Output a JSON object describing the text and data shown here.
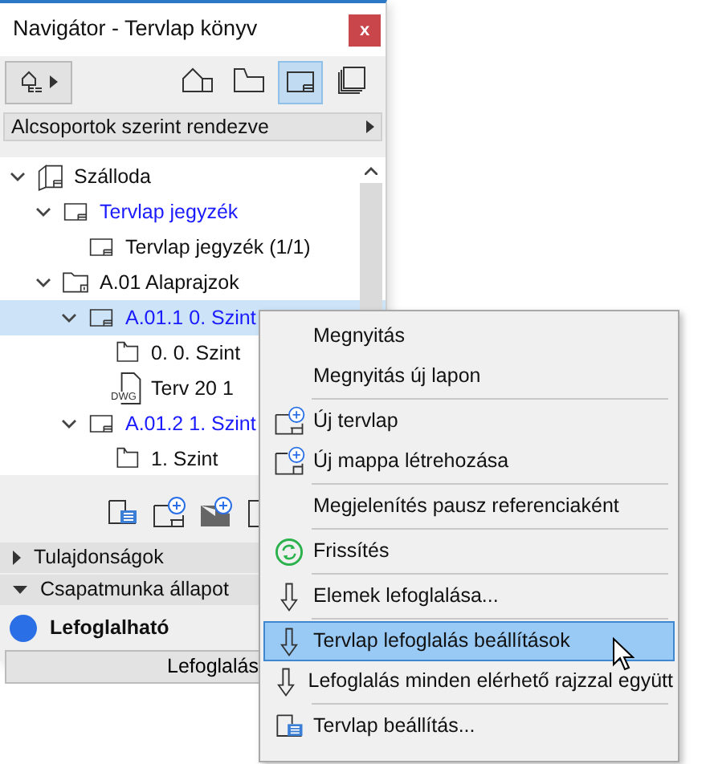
{
  "window": {
    "title": "Navigátor - Tervlap könyv",
    "close_label": "x"
  },
  "toolbar": {
    "views": [
      {
        "kind": "model",
        "selected": false
      },
      {
        "kind": "plan",
        "selected": false
      },
      {
        "kind": "layout",
        "selected": true
      },
      {
        "kind": "publish",
        "selected": false
      }
    ]
  },
  "sort_bar": {
    "label": "Alcsoportok szerint rendezve"
  },
  "tree": [
    {
      "label": "Szálloda",
      "kind": "book",
      "expanded": true,
      "selected": false,
      "children": [
        {
          "label": "Tervlap jegyzék",
          "kind": "layout",
          "color": "#1a1aff",
          "expanded": true,
          "selected": false,
          "children": [
            {
              "label": "Tervlap jegyzék (1/1)",
              "kind": "layout",
              "selected": false
            }
          ]
        },
        {
          "label": "A.01 Alaprajzok",
          "kind": "folder",
          "expanded": true,
          "selected": false,
          "children": [
            {
              "label": "A.01.1 0. Szint",
              "kind": "layout",
              "color": "#1a1aff",
              "expanded": true,
              "selected": true,
              "children": [
                {
                  "label": "0. 0. Szint",
                  "kind": "view",
                  "selected": false
                },
                {
                  "label": "Terv 20 1",
                  "kind": "dwg",
                  "file_type": "DWG",
                  "selected": false
                }
              ]
            },
            {
              "label": "A.01.2 1. Szint",
              "kind": "layout",
              "color": "#1a1aff",
              "expanded": true,
              "selected": false,
              "children": [
                {
                  "label": "1. Szint",
                  "kind": "view",
                  "selected": false
                }
              ]
            }
          ]
        }
      ]
    }
  ],
  "bottom_tools": [
    {
      "kind": "settings"
    },
    {
      "kind": "new-layout"
    },
    {
      "kind": "new-folder"
    },
    {
      "kind": "other"
    }
  ],
  "sections": [
    {
      "label": "Tulajdonságok",
      "expanded": false
    },
    {
      "label": "Csapatmunka állapot",
      "expanded": true
    }
  ],
  "status": {
    "label": "Lefoglalható",
    "color": "#2a6fe6"
  },
  "reserve_button": "Lefoglalás",
  "context_menu": [
    {
      "kind": "plain",
      "label": "Megnyitás",
      "selected": false
    },
    {
      "kind": "plain",
      "label": "Megnyitás új lapon",
      "selected": false
    },
    {
      "kind": "separator"
    },
    {
      "kind": "new-layout",
      "label": "Új tervlap",
      "selected": false
    },
    {
      "kind": "new-folder",
      "label": "Új mappa létrehozása",
      "selected": false
    },
    {
      "kind": "separator"
    },
    {
      "kind": "plain",
      "label": "Megjelenítés pausz referenciaként",
      "selected": false
    },
    {
      "kind": "separator"
    },
    {
      "kind": "refresh",
      "label": "Frissítés",
      "selected": false
    },
    {
      "kind": "separator"
    },
    {
      "kind": "down",
      "label": "Elemek lefoglalása...",
      "selected": false
    },
    {
      "kind": "separator"
    },
    {
      "kind": "down",
      "label": "Tervlap lefoglalás beállítások",
      "selected": true
    },
    {
      "kind": "down",
      "label": "Lefoglalás minden elérhető rajzzal együtt",
      "selected": false
    },
    {
      "kind": "separator"
    },
    {
      "kind": "settings",
      "label": "Tervlap beállítás...",
      "selected": false
    }
  ]
}
